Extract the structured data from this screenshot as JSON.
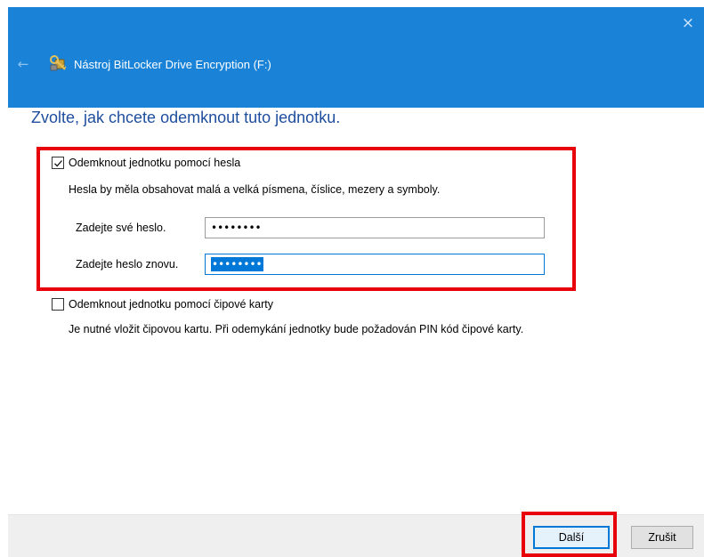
{
  "window": {
    "title": "Nástroj BitLocker Drive Encryption (F:)",
    "back_icon": "arrow-left",
    "close_icon": "×",
    "titlebar_color": "#1a83d8"
  },
  "heading": "Zvolte, jak chcete odemknout tuto jednotku.",
  "password_option": {
    "label": "Odemknout jednotku pomocí hesla",
    "checked": true,
    "hint": "Hesla by měla obsahovat malá a velká písmena, číslice, mezery a symboly.",
    "password_label": "Zadejte své heslo.",
    "password_value": "••••••••",
    "confirm_label": "Zadejte heslo znovu.",
    "confirm_value": "••••••••"
  },
  "smartcard_option": {
    "label": "Odemknout jednotku pomocí čipové karty",
    "checked": false,
    "hint": "Je nutné vložit čipovou kartu. Při odemykání jednotky bude požadován PIN kód čipové karty."
  },
  "footer": {
    "next_label": "Další",
    "cancel_label": "Zrušit"
  },
  "highlight_color": "#e8000b"
}
